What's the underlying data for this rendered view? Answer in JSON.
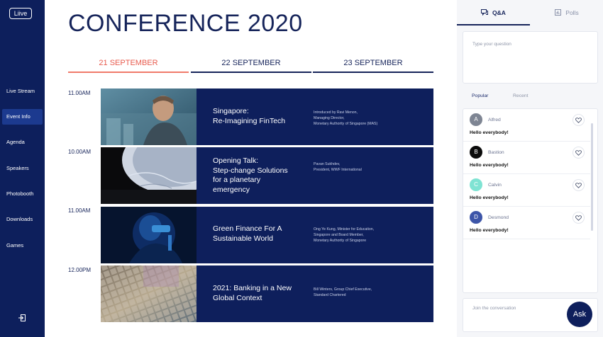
{
  "app": {
    "logo_text": "Liive"
  },
  "sidebar": {
    "items": [
      {
        "label": "Live Stream",
        "active": false
      },
      {
        "label": "Event Info",
        "active": true
      },
      {
        "label": "Agenda",
        "active": false
      },
      {
        "label": "Speakers",
        "active": false
      },
      {
        "label": "Photobooth",
        "active": false
      },
      {
        "label": "Downloads",
        "active": false
      },
      {
        "label": "Games",
        "active": false
      }
    ],
    "exit_icon": "exit-icon"
  },
  "main": {
    "title": "CONFERENCE 2020",
    "days": [
      {
        "label": "21 SEPTEMBER",
        "active": true
      },
      {
        "label": "22 SEPTEMBER",
        "active": false
      },
      {
        "label": "23 SEPTEMBER",
        "active": false
      }
    ],
    "sessions": [
      {
        "time": "11.00AM",
        "title_lines": [
          "Singapore:",
          "Re-Imagining FinTech"
        ],
        "speaker_lines": [
          "Introduced by Ravi Menon,",
          "Managing Director,",
          "Monetary Authority of Singapore (MAS)"
        ]
      },
      {
        "time": "10.00AM",
        "title_lines": [
          "Opening Talk:",
          "Step-change Solutions",
          "for a planetary",
          "emergency"
        ],
        "speaker_lines": [
          "Pavan Sukhdev,",
          "President, WWF International"
        ]
      },
      {
        "time": "11.00AM",
        "title_lines": [
          "Green Finance For A",
          "Sustainable World"
        ],
        "speaker_lines": [
          "Ong Ye Kung, Minister for Education,",
          "Singapore and Board Member,",
          "Monetary Authority of Singapore"
        ]
      },
      {
        "time": "12.00PM",
        "title_lines": [
          "2021: Banking in a New",
          "Global Context"
        ],
        "speaker_lines": [
          "Bill Winters, Group Chief Executive,",
          "Standard Chartered"
        ]
      }
    ]
  },
  "panel": {
    "tabs": [
      {
        "label": "Q&A",
        "icon": "chat-icon",
        "active": true
      },
      {
        "label": "Polls",
        "icon": "poll-icon",
        "active": false
      }
    ],
    "question_placeholder": "Type your question",
    "sort_tabs": [
      {
        "label": "Popular",
        "active": true
      },
      {
        "label": "Recent",
        "active": false
      }
    ],
    "comments": [
      {
        "initial": "A",
        "name": "Alfred",
        "message": "Hello everybody!",
        "color": "#7e8593"
      },
      {
        "initial": "B",
        "name": "Bastion",
        "message": "Hello everybody!",
        "color": "#0b0b0b"
      },
      {
        "initial": "C",
        "name": "Calvin",
        "message": "Hello everybody!",
        "color": "#7fe3d3"
      },
      {
        "initial": "D",
        "name": "Desmond",
        "message": "Hello everybody!",
        "color": "#3d55a8"
      }
    ],
    "join_placeholder": "Join the conversation",
    "ask_label": "Ask"
  },
  "colors": {
    "navy": "#0e1f5c",
    "accent": "#e85b4e",
    "active_nav": "#1c3a8f"
  }
}
